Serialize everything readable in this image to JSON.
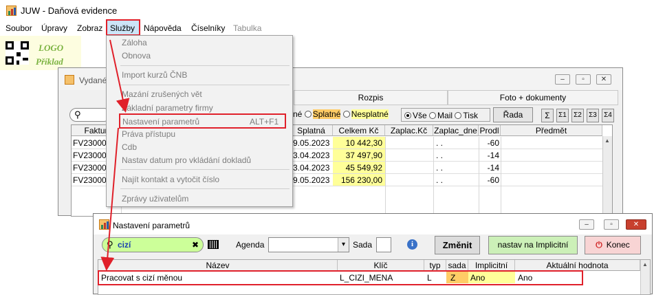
{
  "app": {
    "title": "JUW - Daňová evidence"
  },
  "menubar": {
    "items": [
      "Soubor",
      "Úpravy",
      "Zobraz",
      "Služby",
      "Nápověda",
      "Číselníky",
      "Tabulka"
    ]
  },
  "logo": {
    "line1": "LOGO",
    "line2": "Příklad"
  },
  "services_menu": {
    "items": [
      {
        "label": "Záloha"
      },
      {
        "label": "Obnova"
      },
      {
        "label": "Import kurzů ČNB"
      },
      {
        "label": "Mazání zrušených vět"
      },
      {
        "label": "Základní parametry firmy"
      },
      {
        "label": "Nastavení parametrů",
        "shortcut": "ALT+F1"
      },
      {
        "label": "Práva přístupu"
      },
      {
        "label": "Cdb"
      },
      {
        "label": "Nastav datum pro vkládání dokladů"
      },
      {
        "label": "Najít kontakt a vytočit číslo"
      },
      {
        "label": "Zprávy uživatelům"
      }
    ]
  },
  "invoices_window": {
    "title": "Vydané",
    "tabs": [
      "Rozpis",
      "Foto + dokumenty"
    ],
    "filters": {
      "status": [
        "né",
        "Splatné",
        "Nesplatné"
      ],
      "channel": [
        "Vše",
        "Mail",
        "Tisk"
      ],
      "row_button": "Řada",
      "sum_buttons": [
        "Σ",
        "Σ1",
        "Σ2",
        "Σ3",
        "Σ4"
      ]
    },
    "columns": [
      "Faktur",
      "Splatná",
      "Celkem Kč",
      "Zaplac.Kč",
      "Zaplac_dne",
      "Prodl",
      "Předmět"
    ],
    "rows": [
      {
        "id": "FV23000",
        "due": "9.05.2023",
        "total": "10 442,30",
        "paid": "",
        "paid_date": ". .",
        "delay": "-60",
        "subject": ""
      },
      {
        "id": "FV23000",
        "due": "3.04.2023",
        "total": "37 497,90",
        "paid": "",
        "paid_date": ". .",
        "delay": "-14",
        "subject": ""
      },
      {
        "id": "FV23000",
        "due": "3.04.2023",
        "total": "45 549,92",
        "paid": "",
        "paid_date": ". .",
        "delay": "-14",
        "subject": ""
      },
      {
        "id": "FV23000",
        "due": "9.05.2023",
        "total": "156 230,00",
        "paid": "",
        "paid_date": ". .",
        "delay": "-60",
        "subject": ""
      }
    ]
  },
  "settings_window": {
    "title": "Nastavení parametrů",
    "search_value": "cizí",
    "agenda_label": "Agenda",
    "agenda_value": "",
    "sada_label": "Sada",
    "sada_value": "",
    "buttons": {
      "change": "Změnit",
      "set_default": "nastav na Implicitní",
      "end": "Konec"
    },
    "columns": [
      "Název",
      "Klíč",
      "typ",
      "sada",
      "Implicitní",
      "Aktuální hodnota"
    ],
    "rows": [
      {
        "name": "Pracovat s cizí měnou",
        "key": "L_CIZI_MENA",
        "type": "L",
        "set": "Z",
        "default": "Ano",
        "current": "Ano"
      }
    ]
  },
  "colors": {
    "highlight": "#e0202a",
    "yellow": "#ffff99",
    "orange": "#ffcc66",
    "close": "#c8402e"
  }
}
